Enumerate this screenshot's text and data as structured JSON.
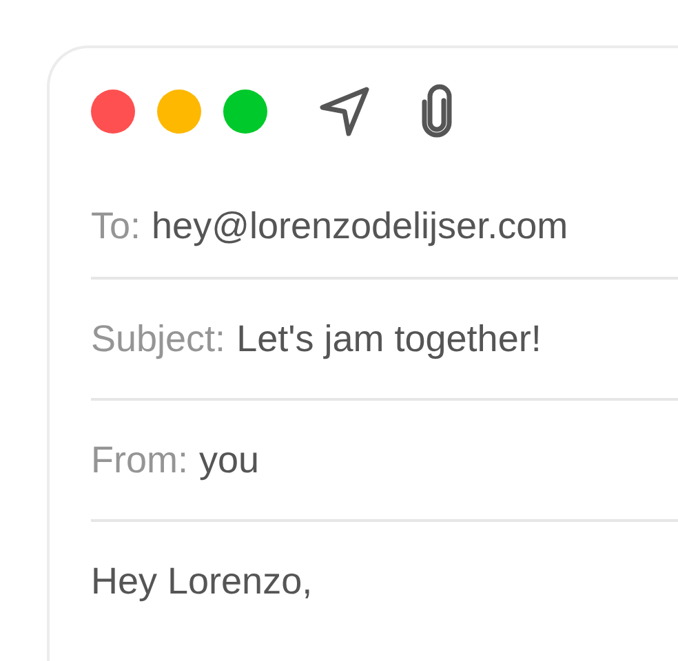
{
  "window": {
    "controls": [
      {
        "color": "#fe5050"
      },
      {
        "color": "#feb800"
      },
      {
        "color": "#00c92b"
      }
    ]
  },
  "fields": [
    {
      "label": "To:",
      "value": "hey@lorenzodelijser.com"
    },
    {
      "label": "Subject:",
      "value": "Let's jam together!"
    },
    {
      "label": "From:",
      "value": "you"
    }
  ],
  "body": "Hey Lorenzo,"
}
